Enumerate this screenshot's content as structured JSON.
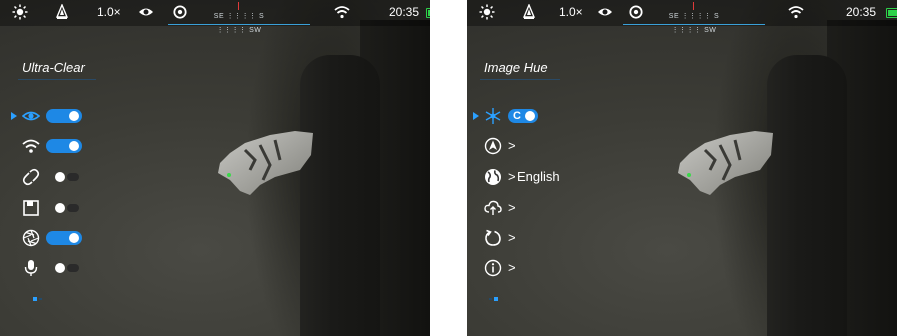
{
  "left_screen": {
    "status": {
      "zoom": "1.0×",
      "time": "20:35",
      "compass": "SE ⋮⋮⋮⋮ S ⋮⋮⋮⋮ SW"
    },
    "menu_title": "Ultra-Clear",
    "rows": [
      {
        "icon": "eye-icon",
        "control": "toggle",
        "state": "on",
        "selected": true
      },
      {
        "icon": "wifi-icon",
        "control": "toggle",
        "state": "on"
      },
      {
        "icon": "hotspot-link-icon",
        "control": "toggle",
        "state": "off"
      },
      {
        "icon": "memory-card-icon",
        "control": "toggle",
        "state": "off"
      },
      {
        "icon": "shutter-aperture-icon",
        "control": "toggle",
        "state": "on"
      },
      {
        "icon": "microphone-icon",
        "control": "toggle",
        "state": "off"
      }
    ]
  },
  "right_screen": {
    "status": {
      "zoom": "1.0×",
      "time": "20:35",
      "compass": "SE ⋮⋮⋮⋮ S ⋮⋮⋮⋮ SW"
    },
    "menu_title": "Image Hue",
    "rows": [
      {
        "icon": "snowflake-icon",
        "control": "toggle",
        "toggle_label": "C",
        "state": "on",
        "selected": true
      },
      {
        "icon": "compass-navigation-icon",
        "arrow": ">"
      },
      {
        "icon": "globe-icon",
        "arrow": ">",
        "text": "English"
      },
      {
        "icon": "cloud-upload-icon",
        "arrow": ">"
      },
      {
        "icon": "restore-icon",
        "arrow": ">"
      },
      {
        "icon": "info-icon",
        "arrow": ">"
      }
    ]
  },
  "colors": {
    "accent": "#1e88e5",
    "battery": "#2dd24a",
    "compass_line": "#3aa0d8"
  }
}
